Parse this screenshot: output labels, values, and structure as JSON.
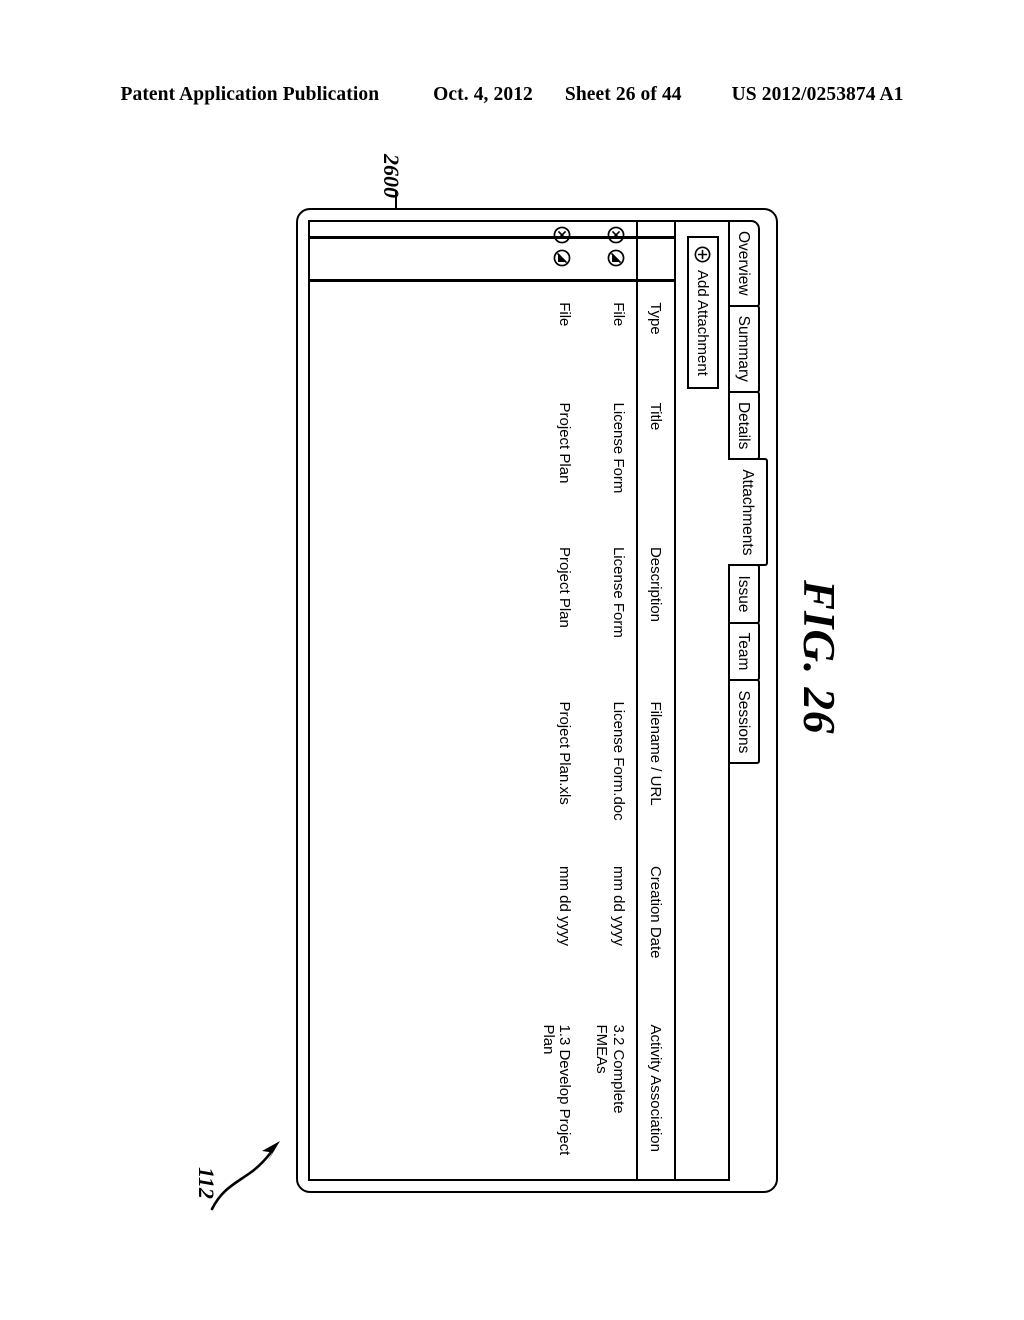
{
  "patent_header": {
    "publication": "Patent Application Publication",
    "date": "Oct. 4, 2012",
    "sheet": "Sheet 26 of 44",
    "number": "US 2012/0253874 A1"
  },
  "figure": {
    "caption": "FIG. 26",
    "ref_window": "2600",
    "ref_pointer": "112"
  },
  "window": {
    "tabs": [
      {
        "label": "Overview",
        "active": false
      },
      {
        "label": "Summary",
        "active": false
      },
      {
        "label": "Details",
        "active": false
      },
      {
        "label": "Attachments",
        "active": true
      },
      {
        "label": "Issue",
        "active": false
      },
      {
        "label": "Team",
        "active": false
      },
      {
        "label": "Sessions",
        "active": false
      }
    ],
    "toolbar": {
      "add_attachment_label": "Add Attachment",
      "add_attachment_icon": "circled-plus-icon"
    },
    "table": {
      "columns": [
        "Type",
        "Title",
        "Description",
        "Filename / URL",
        "Creation Date",
        "Activity Association"
      ],
      "row_action_icons": [
        "circled-x-icon",
        "circled-slash-icon"
      ],
      "rows": [
        {
          "type": "File",
          "title": "License Form",
          "description": "License Form",
          "filename_url": "License Form.doc",
          "creation_date": "mm dd yyyy",
          "activity_association_line1": "3.2 Complete",
          "activity_association_line2": "FMEAs"
        },
        {
          "type": "File",
          "title": "Project Plan",
          "description": "Project Plan",
          "filename_url": "Project Plan.xls",
          "creation_date": "mm dd yyyy",
          "activity_association_line1": "1.3 Develop Project",
          "activity_association_line2": "Plan"
        }
      ]
    }
  }
}
